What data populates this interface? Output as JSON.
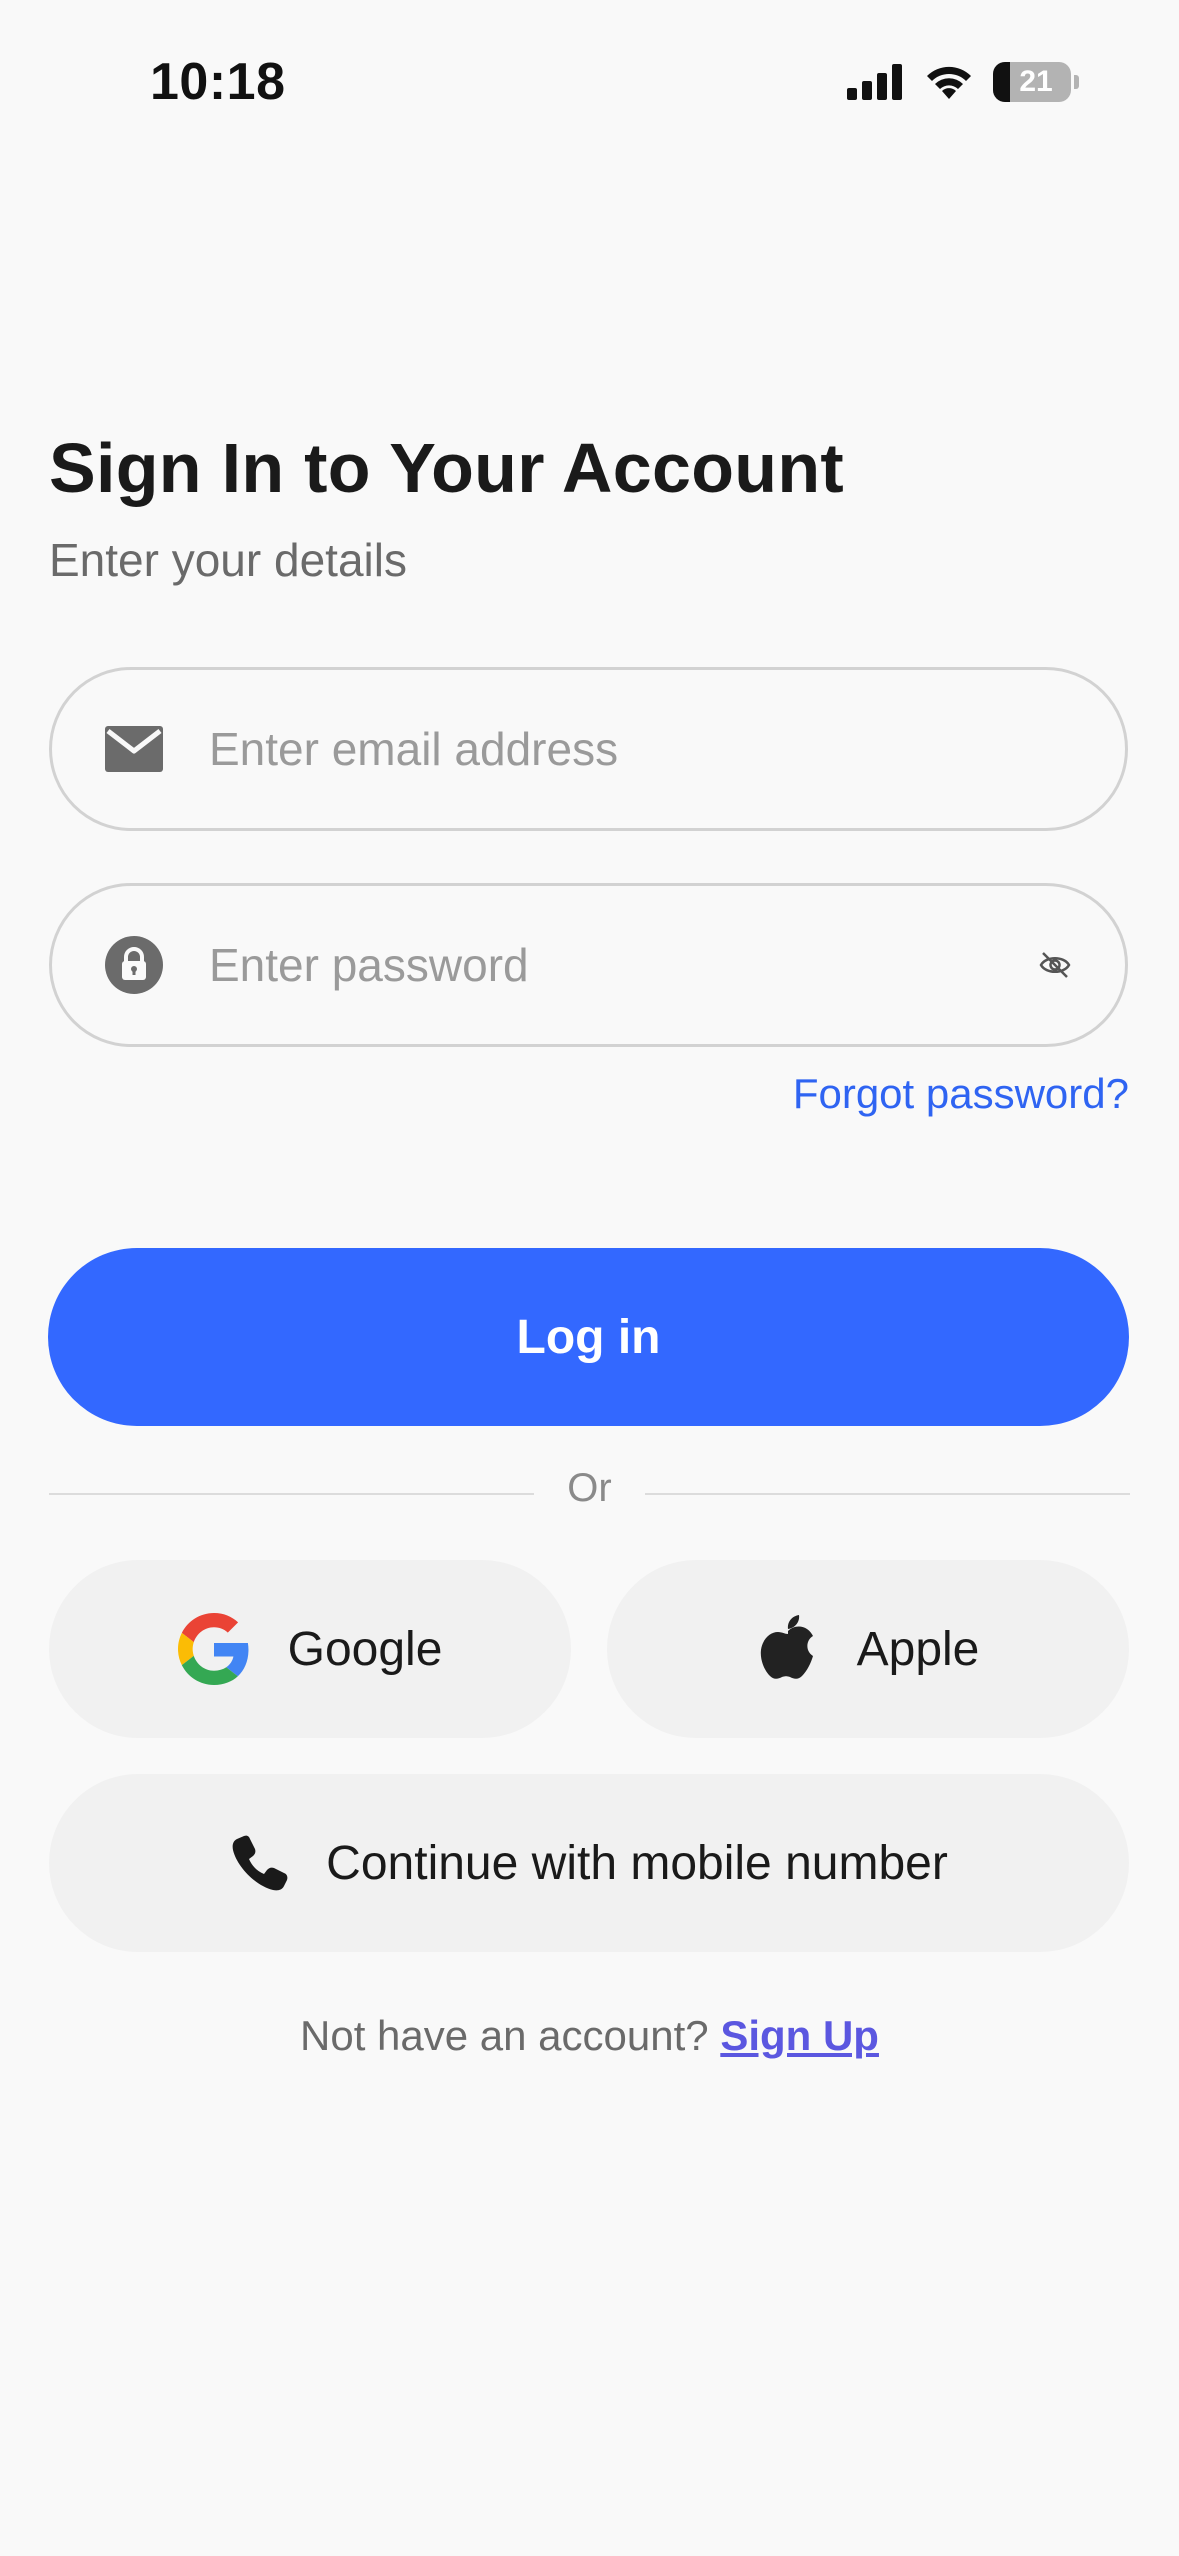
{
  "status_bar": {
    "time": "10:18",
    "battery": "21",
    "icons": [
      "signal-icon",
      "wifi-icon",
      "battery-icon"
    ]
  },
  "header": {
    "title": "Sign In to Your Account",
    "subtitle": "Enter your details"
  },
  "form": {
    "email_placeholder": "Enter email address",
    "email_value": "",
    "password_placeholder": "Enter password",
    "password_value": "",
    "forgot_password": "Forgot password?",
    "login_label": "Log in"
  },
  "divider": {
    "label": "Or"
  },
  "social": {
    "google_label": "Google",
    "apple_label": "Apple",
    "mobile_label": "Continue with mobile number"
  },
  "footer": {
    "prompt": "Not have an account?",
    "signup_label": "Sign Up"
  },
  "colors": {
    "primary": "#3368ff",
    "link": "#2f64f2",
    "signup_link": "#5b57e0",
    "background": "#f9f9f9"
  }
}
